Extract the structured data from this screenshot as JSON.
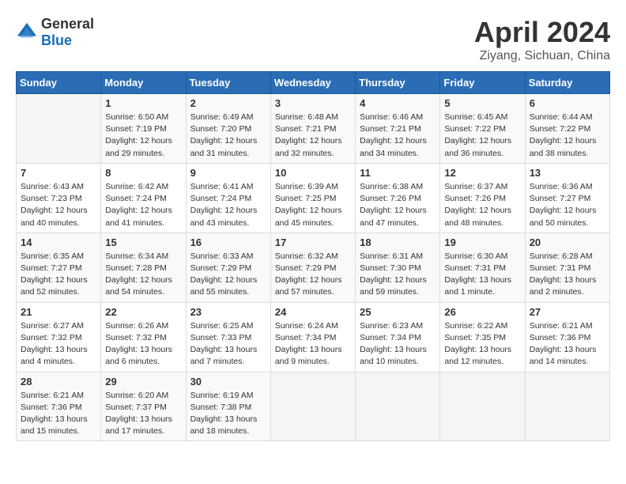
{
  "header": {
    "logo_general": "General",
    "logo_blue": "Blue",
    "month_title": "April 2024",
    "location": "Ziyang, Sichuan, China"
  },
  "days_of_week": [
    "Sunday",
    "Monday",
    "Tuesday",
    "Wednesday",
    "Thursday",
    "Friday",
    "Saturday"
  ],
  "weeks": [
    [
      {
        "day": "",
        "sunrise": "",
        "sunset": "",
        "daylight": ""
      },
      {
        "day": "1",
        "sunrise": "Sunrise: 6:50 AM",
        "sunset": "Sunset: 7:19 PM",
        "daylight": "Daylight: 12 hours and 29 minutes."
      },
      {
        "day": "2",
        "sunrise": "Sunrise: 6:49 AM",
        "sunset": "Sunset: 7:20 PM",
        "daylight": "Daylight: 12 hours and 31 minutes."
      },
      {
        "day": "3",
        "sunrise": "Sunrise: 6:48 AM",
        "sunset": "Sunset: 7:21 PM",
        "daylight": "Daylight: 12 hours and 32 minutes."
      },
      {
        "day": "4",
        "sunrise": "Sunrise: 6:46 AM",
        "sunset": "Sunset: 7:21 PM",
        "daylight": "Daylight: 12 hours and 34 minutes."
      },
      {
        "day": "5",
        "sunrise": "Sunrise: 6:45 AM",
        "sunset": "Sunset: 7:22 PM",
        "daylight": "Daylight: 12 hours and 36 minutes."
      },
      {
        "day": "6",
        "sunrise": "Sunrise: 6:44 AM",
        "sunset": "Sunset: 7:22 PM",
        "daylight": "Daylight: 12 hours and 38 minutes."
      }
    ],
    [
      {
        "day": "7",
        "sunrise": "Sunrise: 6:43 AM",
        "sunset": "Sunset: 7:23 PM",
        "daylight": "Daylight: 12 hours and 40 minutes."
      },
      {
        "day": "8",
        "sunrise": "Sunrise: 6:42 AM",
        "sunset": "Sunset: 7:24 PM",
        "daylight": "Daylight: 12 hours and 41 minutes."
      },
      {
        "day": "9",
        "sunrise": "Sunrise: 6:41 AM",
        "sunset": "Sunset: 7:24 PM",
        "daylight": "Daylight: 12 hours and 43 minutes."
      },
      {
        "day": "10",
        "sunrise": "Sunrise: 6:39 AM",
        "sunset": "Sunset: 7:25 PM",
        "daylight": "Daylight: 12 hours and 45 minutes."
      },
      {
        "day": "11",
        "sunrise": "Sunrise: 6:38 AM",
        "sunset": "Sunset: 7:26 PM",
        "daylight": "Daylight: 12 hours and 47 minutes."
      },
      {
        "day": "12",
        "sunrise": "Sunrise: 6:37 AM",
        "sunset": "Sunset: 7:26 PM",
        "daylight": "Daylight: 12 hours and 48 minutes."
      },
      {
        "day": "13",
        "sunrise": "Sunrise: 6:36 AM",
        "sunset": "Sunset: 7:27 PM",
        "daylight": "Daylight: 12 hours and 50 minutes."
      }
    ],
    [
      {
        "day": "14",
        "sunrise": "Sunrise: 6:35 AM",
        "sunset": "Sunset: 7:27 PM",
        "daylight": "Daylight: 12 hours and 52 minutes."
      },
      {
        "day": "15",
        "sunrise": "Sunrise: 6:34 AM",
        "sunset": "Sunset: 7:28 PM",
        "daylight": "Daylight: 12 hours and 54 minutes."
      },
      {
        "day": "16",
        "sunrise": "Sunrise: 6:33 AM",
        "sunset": "Sunset: 7:29 PM",
        "daylight": "Daylight: 12 hours and 55 minutes."
      },
      {
        "day": "17",
        "sunrise": "Sunrise: 6:32 AM",
        "sunset": "Sunset: 7:29 PM",
        "daylight": "Daylight: 12 hours and 57 minutes."
      },
      {
        "day": "18",
        "sunrise": "Sunrise: 6:31 AM",
        "sunset": "Sunset: 7:30 PM",
        "daylight": "Daylight: 12 hours and 59 minutes."
      },
      {
        "day": "19",
        "sunrise": "Sunrise: 6:30 AM",
        "sunset": "Sunset: 7:31 PM",
        "daylight": "Daylight: 13 hours and 1 minute."
      },
      {
        "day": "20",
        "sunrise": "Sunrise: 6:28 AM",
        "sunset": "Sunset: 7:31 PM",
        "daylight": "Daylight: 13 hours and 2 minutes."
      }
    ],
    [
      {
        "day": "21",
        "sunrise": "Sunrise: 6:27 AM",
        "sunset": "Sunset: 7:32 PM",
        "daylight": "Daylight: 13 hours and 4 minutes."
      },
      {
        "day": "22",
        "sunrise": "Sunrise: 6:26 AM",
        "sunset": "Sunset: 7:32 PM",
        "daylight": "Daylight: 13 hours and 6 minutes."
      },
      {
        "day": "23",
        "sunrise": "Sunrise: 6:25 AM",
        "sunset": "Sunset: 7:33 PM",
        "daylight": "Daylight: 13 hours and 7 minutes."
      },
      {
        "day": "24",
        "sunrise": "Sunrise: 6:24 AM",
        "sunset": "Sunset: 7:34 PM",
        "daylight": "Daylight: 13 hours and 9 minutes."
      },
      {
        "day": "25",
        "sunrise": "Sunrise: 6:23 AM",
        "sunset": "Sunset: 7:34 PM",
        "daylight": "Daylight: 13 hours and 10 minutes."
      },
      {
        "day": "26",
        "sunrise": "Sunrise: 6:22 AM",
        "sunset": "Sunset: 7:35 PM",
        "daylight": "Daylight: 13 hours and 12 minutes."
      },
      {
        "day": "27",
        "sunrise": "Sunrise: 6:21 AM",
        "sunset": "Sunset: 7:36 PM",
        "daylight": "Daylight: 13 hours and 14 minutes."
      }
    ],
    [
      {
        "day": "28",
        "sunrise": "Sunrise: 6:21 AM",
        "sunset": "Sunset: 7:36 PM",
        "daylight": "Daylight: 13 hours and 15 minutes."
      },
      {
        "day": "29",
        "sunrise": "Sunrise: 6:20 AM",
        "sunset": "Sunset: 7:37 PM",
        "daylight": "Daylight: 13 hours and 17 minutes."
      },
      {
        "day": "30",
        "sunrise": "Sunrise: 6:19 AM",
        "sunset": "Sunset: 7:38 PM",
        "daylight": "Daylight: 13 hours and 18 minutes."
      },
      {
        "day": "",
        "sunrise": "",
        "sunset": "",
        "daylight": ""
      },
      {
        "day": "",
        "sunrise": "",
        "sunset": "",
        "daylight": ""
      },
      {
        "day": "",
        "sunrise": "",
        "sunset": "",
        "daylight": ""
      },
      {
        "day": "",
        "sunrise": "",
        "sunset": "",
        "daylight": ""
      }
    ]
  ]
}
